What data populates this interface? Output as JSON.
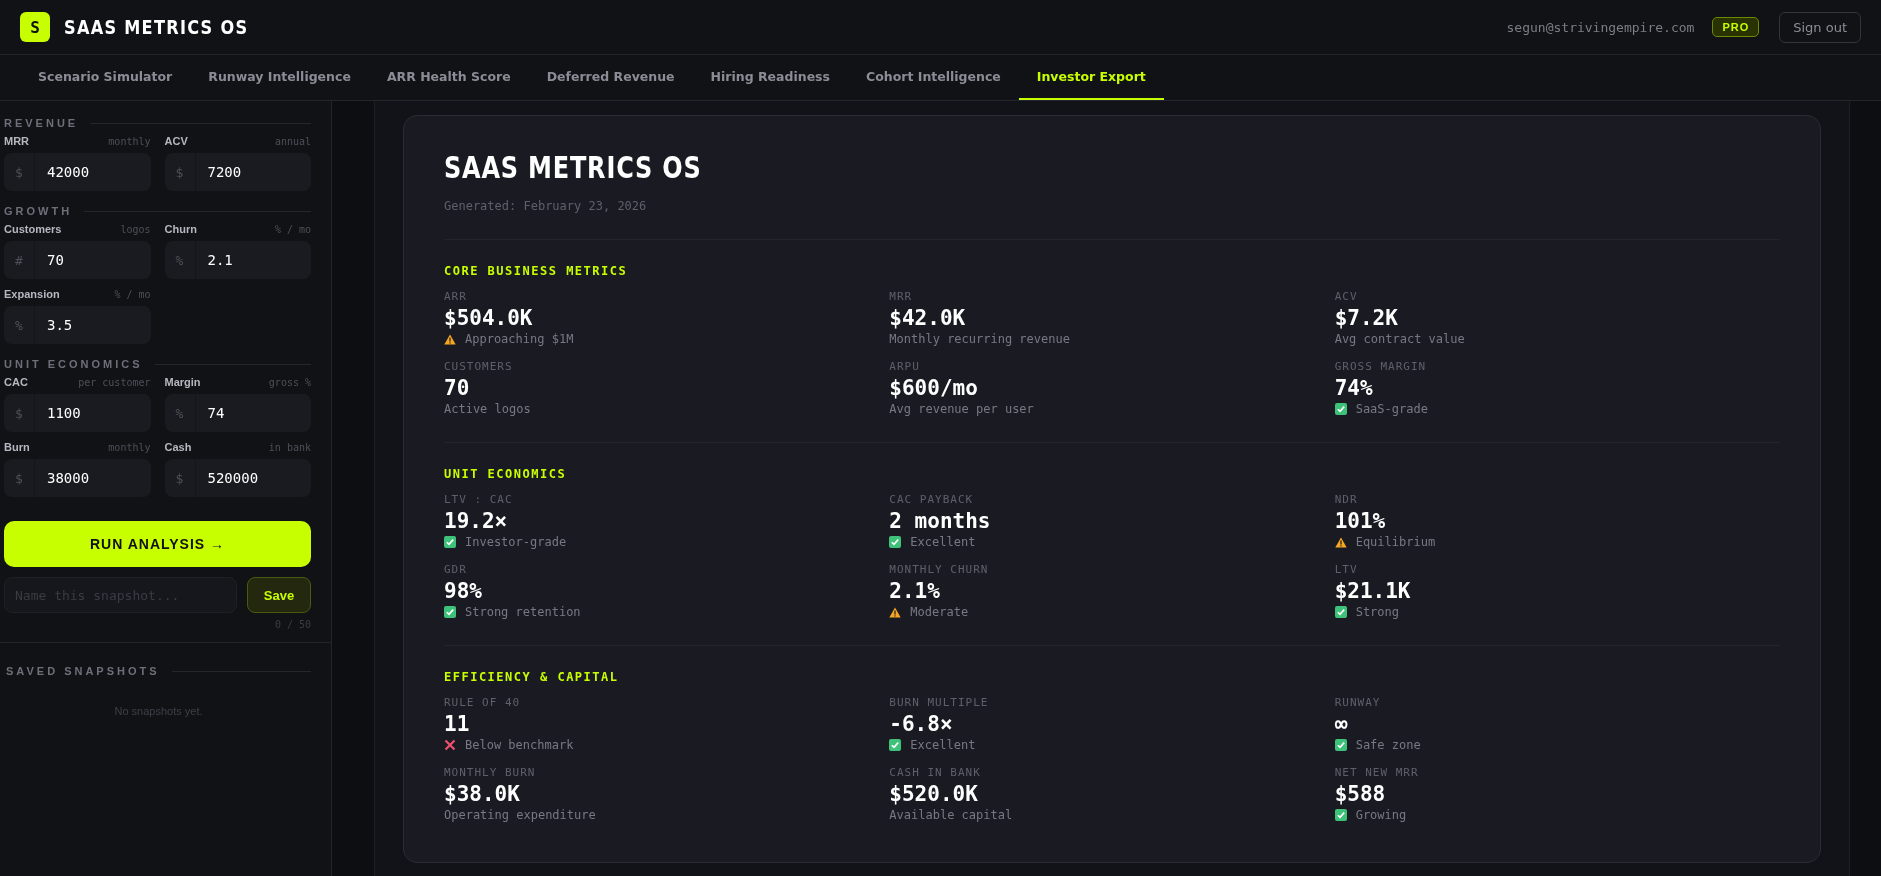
{
  "app": {
    "logo_letter": "S",
    "title": "SAAS METRICS OS",
    "email": "segun@strivingempire.com",
    "plan_badge": "PRO",
    "sign_out": "Sign out"
  },
  "tabs": [
    {
      "label": "Scenario Simulator",
      "selected": false
    },
    {
      "label": "Runway Intelligence",
      "selected": false
    },
    {
      "label": "ARR Health Score",
      "selected": false
    },
    {
      "label": "Deferred Revenue",
      "selected": false
    },
    {
      "label": "Hiring Readiness",
      "selected": false
    },
    {
      "label": "Cohort Intelligence",
      "selected": false
    },
    {
      "label": "Investor Export",
      "selected": true
    }
  ],
  "sidebar": {
    "sections": [
      {
        "title": "REVENUE",
        "fields": [
          {
            "label": "MRR",
            "unit": "monthly",
            "prefix": "$",
            "value": "42000"
          },
          {
            "label": "ACV",
            "unit": "annual",
            "prefix": "$",
            "value": "7200"
          }
        ]
      },
      {
        "title": "GROWTH",
        "fields": [
          {
            "label": "Customers",
            "unit": "logos",
            "prefix": "#",
            "value": "70"
          },
          {
            "label": "Churn",
            "unit": "% / mo",
            "prefix": "%",
            "value": "2.1"
          },
          {
            "label": "Expansion",
            "unit": "% / mo",
            "prefix": "%",
            "value": "3.5"
          }
        ]
      },
      {
        "title": "UNIT ECONOMICS",
        "fields": [
          {
            "label": "CAC",
            "unit": "per customer",
            "prefix": "$",
            "value": "1100"
          },
          {
            "label": "Margin",
            "unit": "gross %",
            "prefix": "%",
            "value": "74"
          },
          {
            "label": "Burn",
            "unit": "monthly",
            "prefix": "$",
            "value": "38000"
          },
          {
            "label": "Cash",
            "unit": "in bank",
            "prefix": "$",
            "value": "520000"
          }
        ]
      }
    ],
    "run_button": "RUN ANALYSIS →",
    "snapshot": {
      "placeholder": "Name this snapshot...",
      "save": "Save",
      "counter": "0 / 50"
    },
    "saved": {
      "title": "SAVED SNAPSHOTS",
      "empty": "No snapshots yet."
    }
  },
  "report": {
    "title": "SAAS METRICS OS",
    "generated": "Generated: February 23, 2026",
    "sections": [
      {
        "title": "CORE BUSINESS METRICS",
        "metrics": [
          {
            "label": "ARR",
            "value": "$504.0K",
            "note": "Approaching $1M",
            "kind": "warn"
          },
          {
            "label": "MRR",
            "value": "$42.0K",
            "note": "Monthly recurring revenue",
            "kind": "plain"
          },
          {
            "label": "ACV",
            "value": "$7.2K",
            "note": "Avg contract value",
            "kind": "plain"
          },
          {
            "label": "CUSTOMERS",
            "value": "70",
            "note": "Active logos",
            "kind": "plain"
          },
          {
            "label": "ARPU",
            "value": "$600/mo",
            "note": "Avg revenue per user",
            "kind": "plain"
          },
          {
            "label": "GROSS MARGIN",
            "value": "74%",
            "note": "SaaS-grade",
            "kind": "ok"
          }
        ]
      },
      {
        "title": "UNIT ECONOMICS",
        "metrics": [
          {
            "label": "LTV : CAC",
            "value": "19.2×",
            "note": "Investor-grade",
            "kind": "ok"
          },
          {
            "label": "CAC PAYBACK",
            "value": "2 months",
            "note": "Excellent",
            "kind": "ok"
          },
          {
            "label": "NDR",
            "value": "101%",
            "note": "Equilibrium",
            "kind": "warn"
          },
          {
            "label": "GDR",
            "value": "98%",
            "note": "Strong retention",
            "kind": "ok"
          },
          {
            "label": "MONTHLY CHURN",
            "value": "2.1%",
            "note": "Moderate",
            "kind": "warn"
          },
          {
            "label": "LTV",
            "value": "$21.1K",
            "note": "Strong",
            "kind": "ok"
          }
        ]
      },
      {
        "title": "EFFICIENCY & CAPITAL",
        "metrics": [
          {
            "label": "RULE OF 40",
            "value": "11",
            "note": "Below benchmark",
            "kind": "bad"
          },
          {
            "label": "BURN MULTIPLE",
            "value": "-6.8×",
            "note": "Excellent",
            "kind": "ok"
          },
          {
            "label": "RUNWAY",
            "value": "∞",
            "note": "Safe zone",
            "kind": "ok"
          },
          {
            "label": "MONTHLY BURN",
            "value": "$38.0K",
            "note": "Operating expenditure",
            "kind": "plain"
          },
          {
            "label": "CASH IN BANK",
            "value": "$520.0K",
            "note": "Available capital",
            "kind": "plain"
          },
          {
            "label": "NET NEW MRR",
            "value": "$588",
            "note": "Growing",
            "kind": "ok"
          }
        ]
      }
    ]
  }
}
